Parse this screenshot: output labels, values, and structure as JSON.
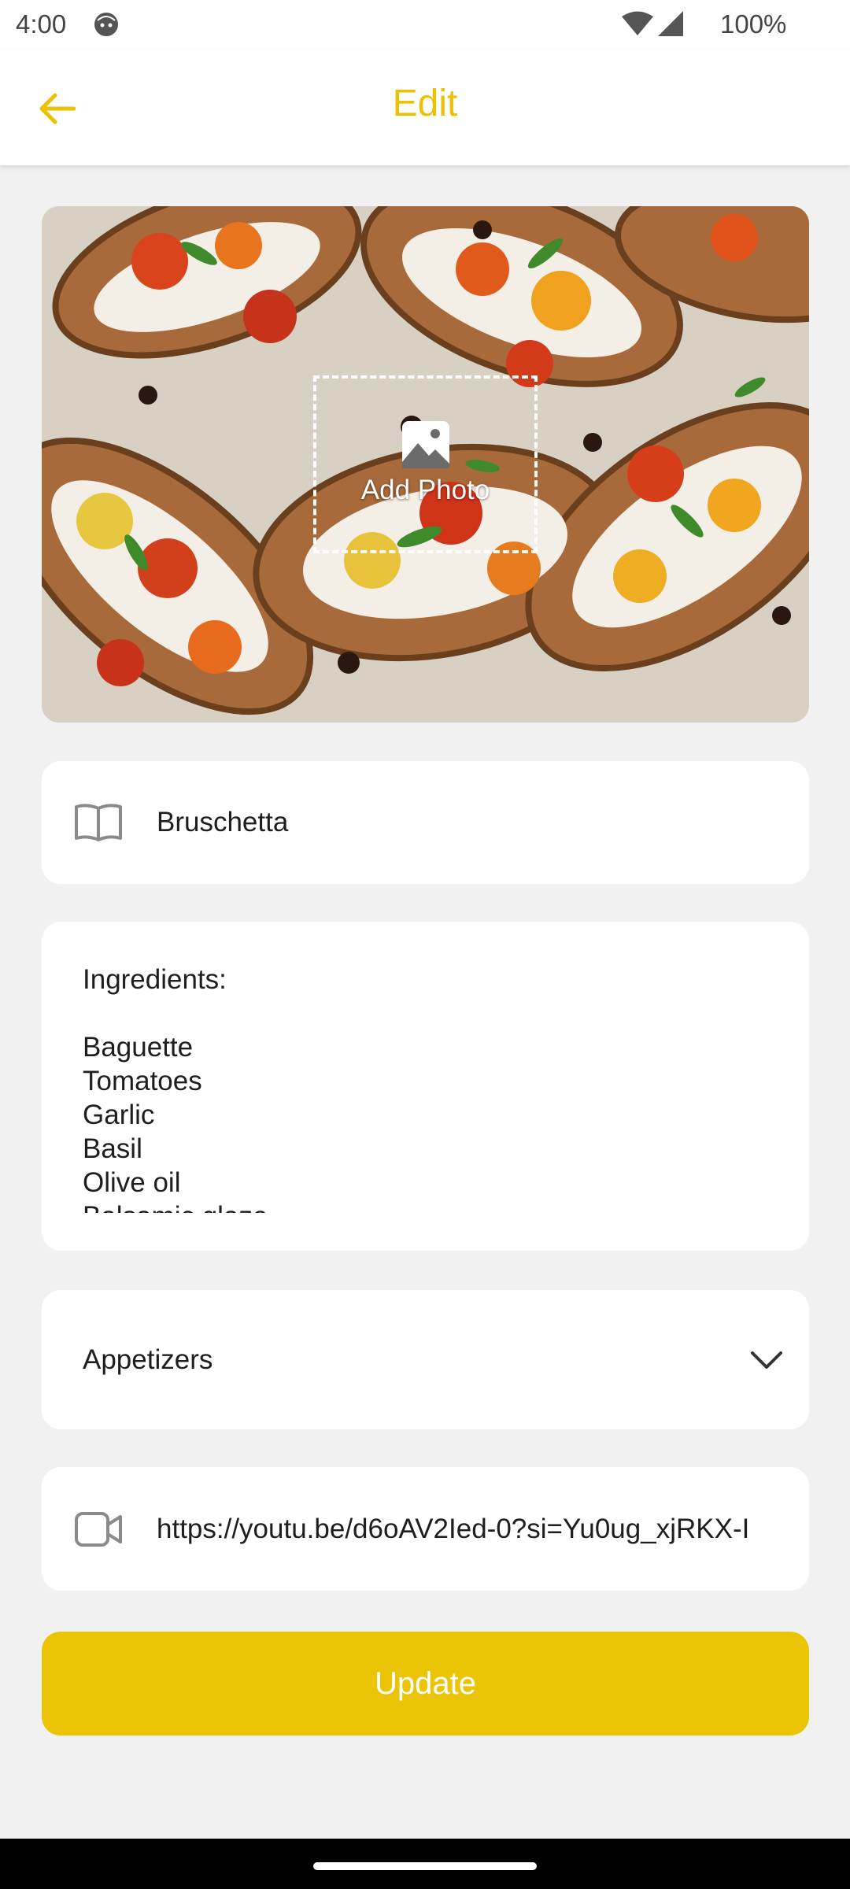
{
  "status_bar": {
    "time": "4:00",
    "battery": "100%"
  },
  "app_bar": {
    "title": "Edit",
    "accent_color": "#ebc106"
  },
  "photo": {
    "add_photo_label": "Add Photo"
  },
  "recipe": {
    "name": "Bruschetta",
    "ingredients_heading": "Ingredients:",
    "ingredients": [
      "Baguette",
      "Tomatoes",
      "Garlic",
      "Basil",
      "Olive oil",
      "Balsamic glaze"
    ],
    "category": "Appetizers",
    "video_url": "https://youtu.be/d6oAV2Ied-0?si=Yu0ug_xjRKX-I"
  },
  "actions": {
    "update_label": "Update",
    "button_color": "#ecc406"
  }
}
